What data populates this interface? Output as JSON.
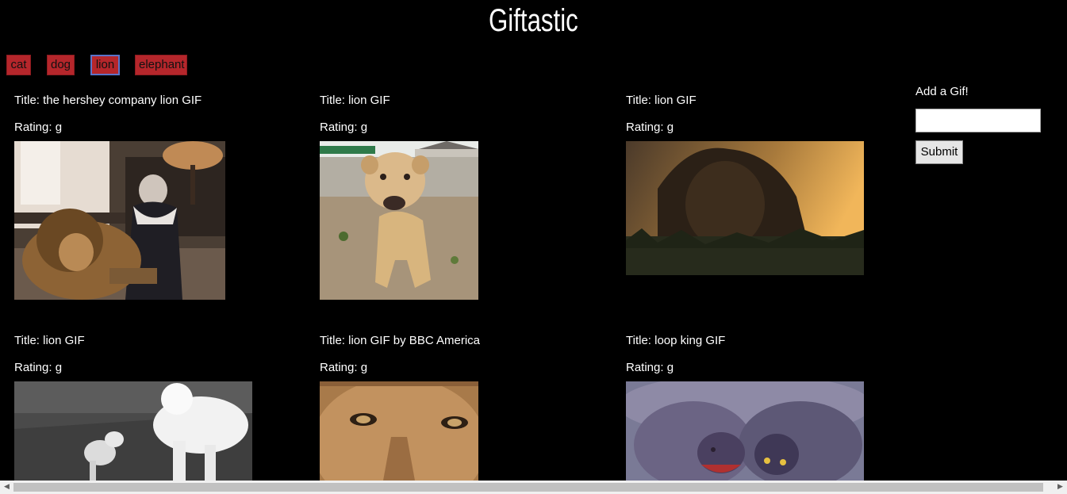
{
  "app": {
    "title": "Giftastic"
  },
  "topics": [
    "cat",
    "dog",
    "lion",
    "elephant"
  ],
  "active_topic": "lion",
  "gifs": [
    {
      "title": "Title: the hershey company lion GIF",
      "rating": "Rating: g",
      "image": "old-woman-with-lion"
    },
    {
      "title": "Title: lion GIF",
      "rating": "Rating: g",
      "image": "lion-cub-roaring"
    },
    {
      "title": "Title: lion GIF",
      "rating": "Rating: g",
      "image": "lion-at-sunset"
    },
    {
      "title": "Title: lion GIF",
      "rating": "Rating: g",
      "image": "white-lion-and-puppy"
    },
    {
      "title": "Title: lion GIF by BBC America",
      "rating": "Rating: g",
      "image": "lioness-face-closeup"
    },
    {
      "title": "Title: loop king GIF",
      "rating": "Rating: g",
      "image": "hyenas-cartoon"
    }
  ],
  "add_form": {
    "label": "Add a Gif!",
    "input_value": "",
    "submit_label": "Submit"
  },
  "colors": {
    "background": "#000000",
    "topic_button": "#b5262b",
    "active_border": "#5a74c9",
    "text": "#ffffff"
  }
}
